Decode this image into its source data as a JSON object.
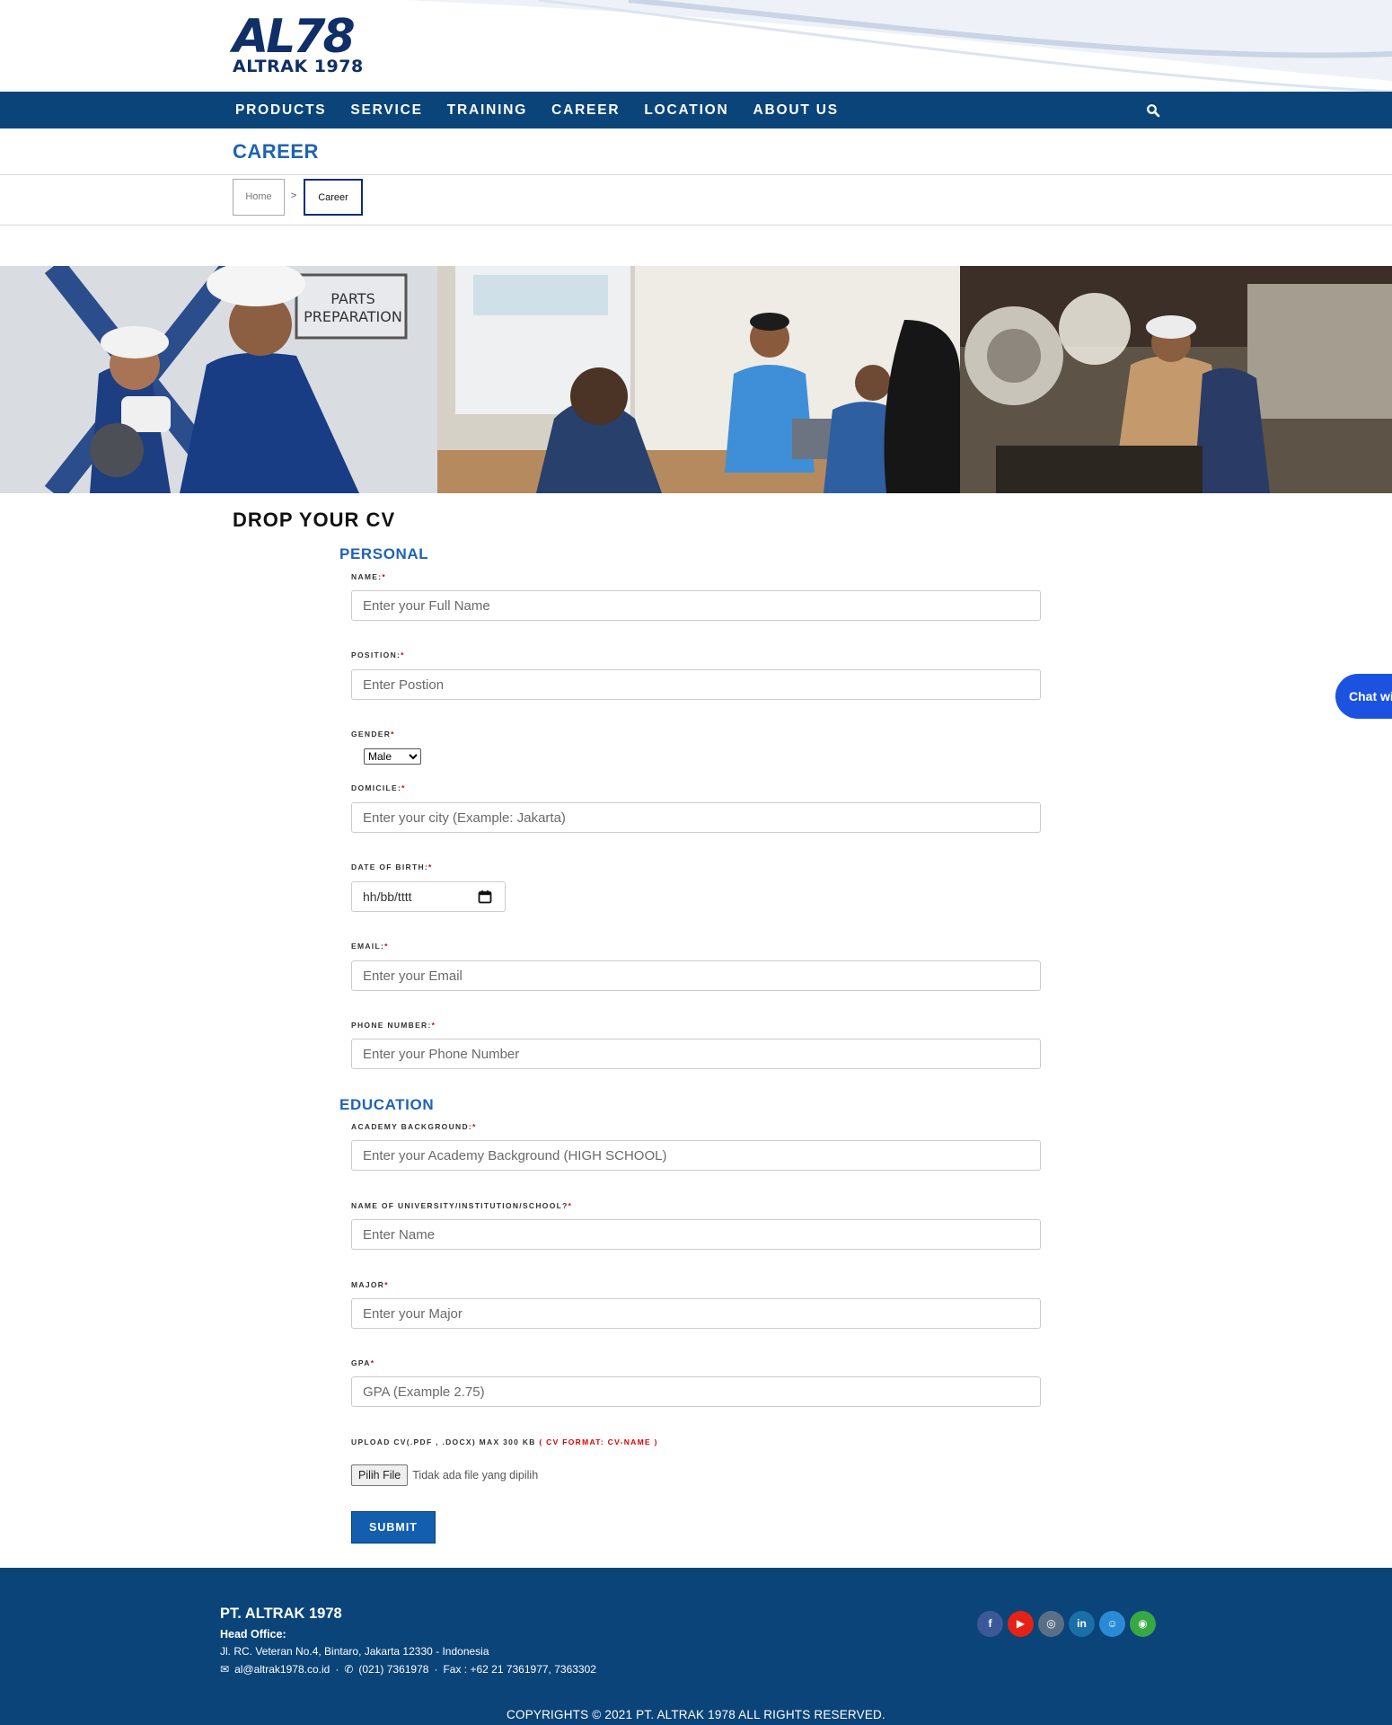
{
  "brand": {
    "mark": "AL78",
    "name": "ALTRAK 1978"
  },
  "nav": {
    "items": [
      "PRODUCTS",
      "SERVICE",
      "TRAINING",
      "CAREER",
      "LOCATION",
      "ABOUT US"
    ]
  },
  "page": {
    "title": "CAREER"
  },
  "breadcrumb": {
    "home": "Home",
    "separator": ">",
    "current": "Career"
  },
  "banner": {
    "panels": [
      {
        "sign_line1": "PARTS",
        "sign_line2": "PREPARATION"
      }
    ]
  },
  "form": {
    "heading": "DROP YOUR CV",
    "personal": {
      "title": "PERSONAL",
      "name_label": "NAME:",
      "name_placeholder": "Enter your Full Name",
      "position_label": "POSITION:",
      "position_placeholder": "Enter Postion",
      "gender_label": "GENDER",
      "gender_value": "Male",
      "domicile_label": "DOMICILE:",
      "domicile_placeholder": "Enter your city (Example: Jakarta)",
      "dob_label": "DATE OF BIRTH:",
      "dob_placeholder": "hh/bb/tttt",
      "email_label": "EMAIL:",
      "email_placeholder": "Enter your Email",
      "phone_label": "PHONE NUMBER:",
      "phone_placeholder": "Enter your Phone Number"
    },
    "education": {
      "title": "EDUCATION",
      "academy_label": "ACADEMY BACKGROUND:",
      "academy_placeholder": "Enter your Academy Background (HIGH SCHOOL)",
      "institution_label": "NAME OF UNIVERSITY/INSTITUTION/SCHOOL?",
      "institution_placeholder": "Enter Name",
      "major_label": "MAJOR",
      "major_placeholder": "Enter your Major",
      "gpa_label": "GPA",
      "gpa_placeholder": "GPA (Example 2.75)"
    },
    "upload": {
      "label": "UPLOAD CV(.PDF , .DOCX) MAX 300 KB",
      "format_note": "( CV FORMAT: CV-NAME )",
      "button": "Pilih File",
      "status": "Tidak ada file yang dipilih"
    },
    "required_mark": "*",
    "submit": "SUBMIT"
  },
  "chat": {
    "label": "Chat wi"
  },
  "footer": {
    "company": "PT. ALTRAK 1978",
    "office_label": "Head Office:",
    "address": "Jl. RC. Veteran No.4, Bintaro, Jakarta 12330 - Indonesia",
    "email": "al@altrak1978.co.id",
    "phone": "(021) 7361978",
    "fax": "Fax : +62 21 7361977, 7363302",
    "dot": "·",
    "copyright": "COPYRIGHTS © 2021 PT. ALTRAK 1978 ALL RIGHTS RESERVED.",
    "social": [
      {
        "icon": "facebook-icon",
        "glyph": "f",
        "color": "#3b5998"
      },
      {
        "icon": "youtube-icon",
        "glyph": "▶",
        "color": "#e62117"
      },
      {
        "icon": "instagram-icon",
        "glyph": "◎",
        "color": "#5a6f86"
      },
      {
        "icon": "linkedin-icon",
        "glyph": "in",
        "color": "#1b6fa8"
      },
      {
        "icon": "mascot-app-icon",
        "glyph": "☺",
        "color": "#2a8ad6"
      },
      {
        "icon": "chat-app-icon",
        "glyph": "◉",
        "color": "#37a844"
      }
    ]
  },
  "colors": {
    "brand_blue": "#0a4479",
    "accent_blue": "#1e63b5",
    "required_red": "#d00000"
  }
}
